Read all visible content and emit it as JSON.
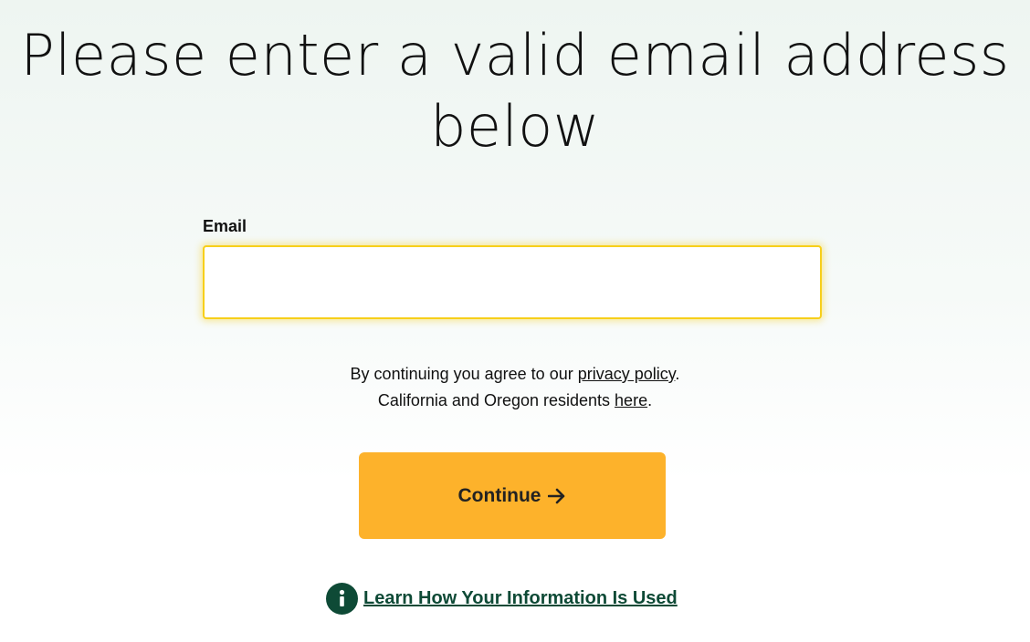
{
  "headline": "Please enter a valid email address below",
  "email": {
    "label": "Email",
    "value": "",
    "placeholder": ""
  },
  "consent": {
    "line1_prefix": "By continuing you agree to our ",
    "privacy_link": "privacy policy",
    "line1_suffix": ".",
    "line2_prefix": "California and Oregon residents ",
    "here_link": "here",
    "line2_suffix": "."
  },
  "continue_button": {
    "label": "Continue",
    "icon": "arrow-right-icon"
  },
  "info_link": {
    "label": "Learn How Your Information Is Used",
    "icon": "info-icon"
  },
  "colors": {
    "accent_button": "#fdb22b",
    "input_focus_border": "#f7cf1a",
    "brand_green": "#0e4a36",
    "background_top": "#eef5f1"
  }
}
